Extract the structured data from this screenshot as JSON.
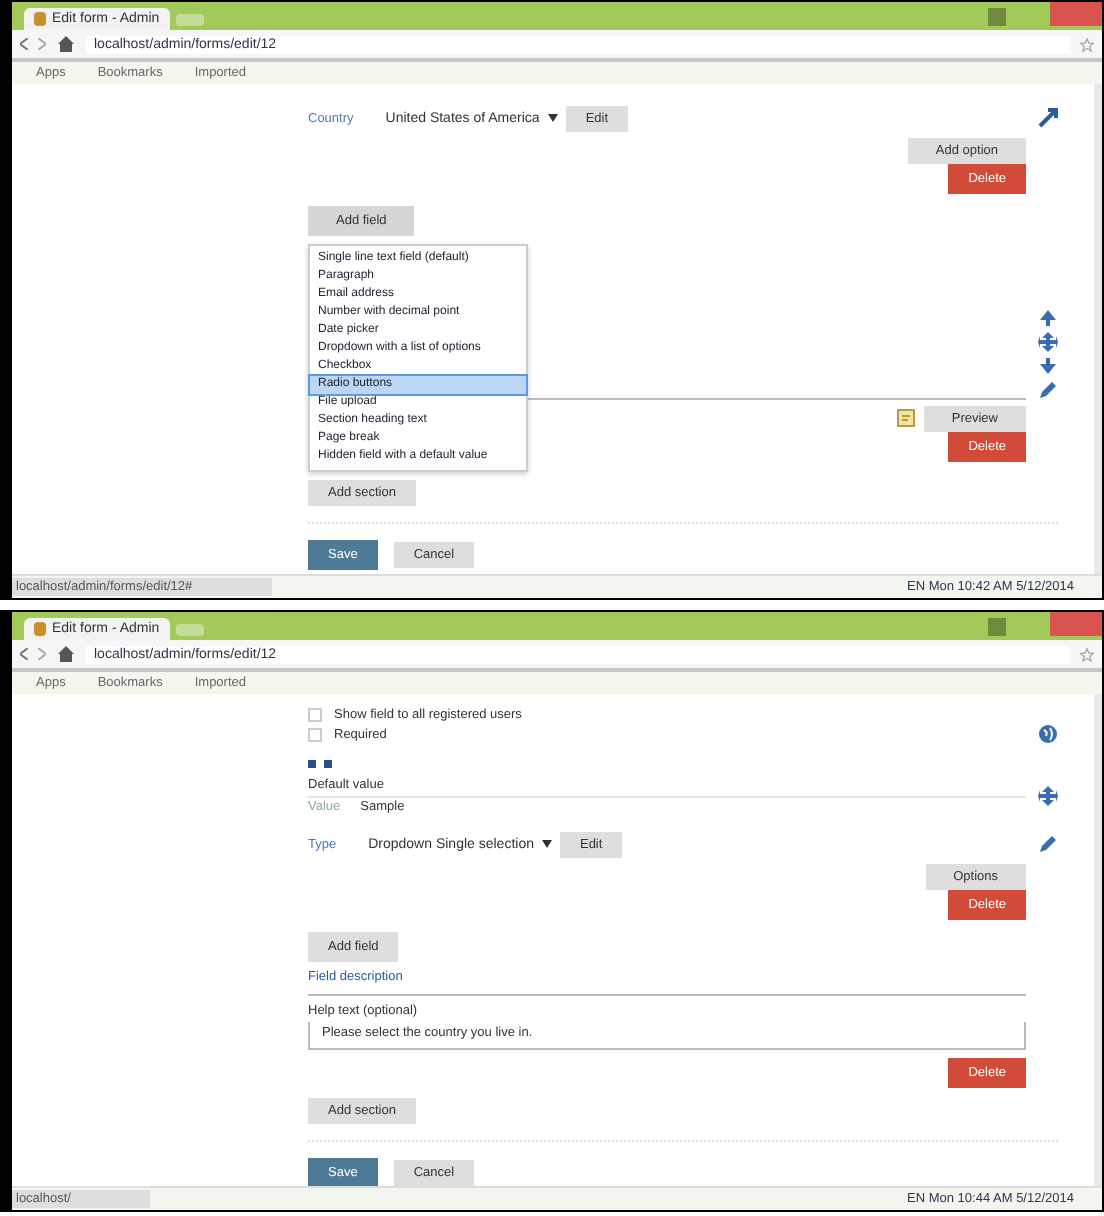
{
  "windows": [
    {
      "tab": {
        "title": "Edit form - Admin"
      },
      "address": "localhost/admin/forms/edit/12",
      "bookmarks": [
        "Apps",
        "Bookmarks",
        "Imported"
      ],
      "content": [
        {
          "kind": "field",
          "label": "Country",
          "value": "United States of America",
          "button": "Edit"
        },
        {
          "kind": "side-button",
          "label": "Add option"
        },
        {
          "kind": "remove",
          "label": "Delete"
        },
        {
          "kind": "menu",
          "label": "Add field",
          "expanded": true,
          "items": [
            {
              "label": "Single line text field (default)",
              "selected": false
            },
            {
              "label": "Paragraph",
              "selected": false
            },
            {
              "label": "Email address",
              "selected": false
            },
            {
              "label": "Number with decimal point",
              "selected": false
            },
            {
              "label": "Date picker",
              "selected": false
            },
            {
              "label": "Dropdown with a list of options",
              "selected": false
            },
            {
              "label": "Checkbox",
              "selected": false
            },
            {
              "label": "Radio buttons",
              "selected": true
            },
            {
              "label": "File upload",
              "selected": false
            },
            {
              "label": "Section heading text",
              "selected": false
            },
            {
              "label": "Page break",
              "selected": false
            },
            {
              "label": "Hidden field with a default value",
              "selected": false
            }
          ]
        },
        {
          "kind": "tools"
        },
        {
          "kind": "side-button",
          "label": "Preview"
        },
        {
          "kind": "remove",
          "label": "Delete"
        },
        {
          "kind": "button",
          "label": "Add section"
        },
        {
          "kind": "actions",
          "buttons": [
            {
              "label": "Save",
              "primary": true
            },
            {
              "label": "Cancel",
              "primary": false
            }
          ]
        }
      ],
      "status_bar": {
        "link": "localhost/admin/forms/edit/12#",
        "tray": "EN  Mon 10:42 AM  5/12/2014"
      }
    },
    {
      "tab": {
        "title": "Edit form - Admin"
      },
      "address": "localhost/admin/forms/edit/12",
      "bookmarks": [
        "Apps",
        "Bookmarks",
        "Imported"
      ],
      "content": [
        {
          "kind": "checkbox",
          "label": "Show field to all registered users",
          "checked": false
        },
        {
          "kind": "checkbox",
          "label": "Required",
          "checked": false
        },
        {
          "kind": "markers"
        },
        {
          "kind": "text-field",
          "label": "Default value",
          "hint": "Value",
          "value": "Sample"
        },
        {
          "kind": "field",
          "label": "Type",
          "value": "Dropdown    Single selection",
          "button": "Edit"
        },
        {
          "kind": "side-button",
          "label": "Options"
        },
        {
          "kind": "remove",
          "label": "Delete"
        },
        {
          "kind": "menu",
          "label": "Add field",
          "expanded": false
        },
        {
          "kind": "link",
          "label": "Field description"
        },
        {
          "kind": "textarea",
          "label": "Help text (optional)",
          "value": "Please select the country you live in."
        },
        {
          "kind": "remove",
          "label": "Delete"
        },
        {
          "kind": "button",
          "label": "Add section"
        },
        {
          "kind": "actions",
          "buttons": [
            {
              "label": "Save",
              "primary": true
            },
            {
              "label": "Cancel",
              "primary": false
            }
          ]
        }
      ],
      "status_bar": {
        "link": "localhost/",
        "tray": "EN  Mon 10:44 AM  5/12/2014"
      }
    }
  ]
}
